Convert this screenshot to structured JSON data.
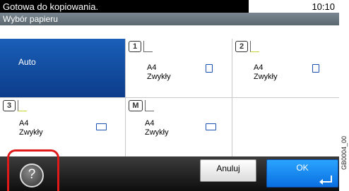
{
  "status": {
    "message": "Gotowa do kopiowania.",
    "time": "10:10"
  },
  "header": {
    "title": "Wybór papieru"
  },
  "options": {
    "auto": {
      "label": "Auto"
    },
    "tray1": {
      "badge": "1",
      "size": "A4",
      "type": "Zwykły"
    },
    "tray2": {
      "badge": "2",
      "size": "A4",
      "type": "Zwykły"
    },
    "tray3": {
      "badge": "3",
      "size": "A4",
      "type": "Zwykły"
    },
    "manual": {
      "badge": "M",
      "size": "A4",
      "type": "Zwykły"
    }
  },
  "footer": {
    "cancel_label": "Anuluj",
    "ok_label": "OK"
  },
  "side_code": "GB0004_00",
  "icons": {
    "help": "help-icon",
    "tray": "paper-tray-icon",
    "orientation": "paper-orientation-icon",
    "enter": "enter-icon"
  },
  "colors": {
    "accent": "#0a6fe0",
    "auto_selected": "#1a5fb8",
    "highlight": "#e01a1a"
  }
}
